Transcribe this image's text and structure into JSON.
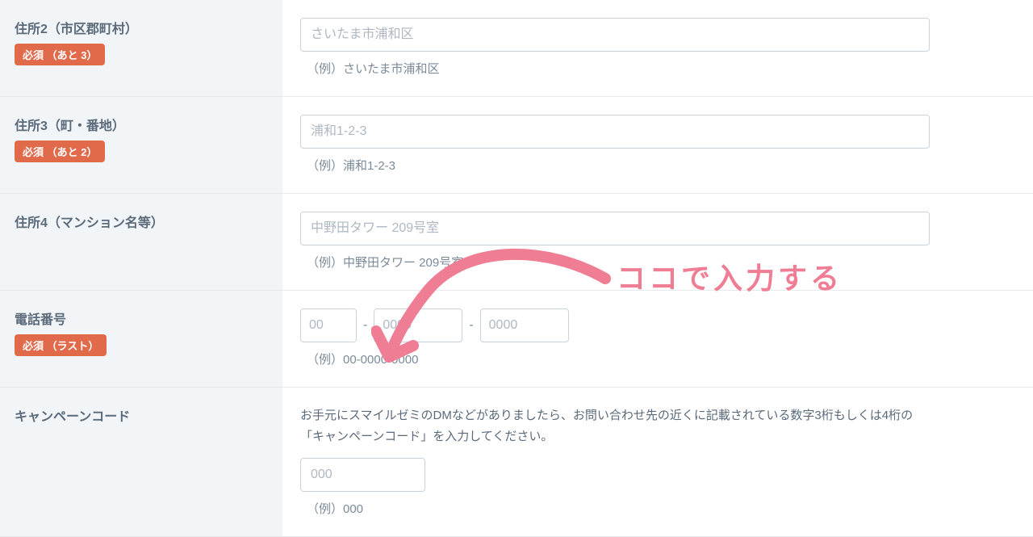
{
  "fields": {
    "address2": {
      "label": "住所2（市区郡町村）",
      "badge": "必須 （あと 3）",
      "placeholder": "さいたま市浦和区",
      "hint": "（例）さいたま市浦和区"
    },
    "address3": {
      "label": "住所3（町・番地）",
      "badge": "必須 （あと 2）",
      "placeholder": "浦和1-2-3",
      "hint": "（例）浦和1-2-3"
    },
    "address4": {
      "label": "住所4（マンション名等）",
      "placeholder": "中野田タワー 209号室",
      "hint": "（例）中野田タワー 209号室"
    },
    "phone": {
      "label": "電話番号",
      "badge": "必須 （ラスト）",
      "p1_placeholder": "00",
      "p2_placeholder": "0000",
      "p3_placeholder": "0000",
      "dash": "-",
      "hint": "（例）00-0000-0000"
    },
    "campaign": {
      "label": "キャンペーンコード",
      "description": "お手元にスマイルゼミのDMなどがありましたら、お問い合わせ先の近くに記載されている数字3桁もしくは4桁の「キャンペーンコード」を入力してください。",
      "placeholder": "000",
      "hint": "（例）000"
    }
  },
  "annotation": {
    "text": "ココで入力する"
  }
}
